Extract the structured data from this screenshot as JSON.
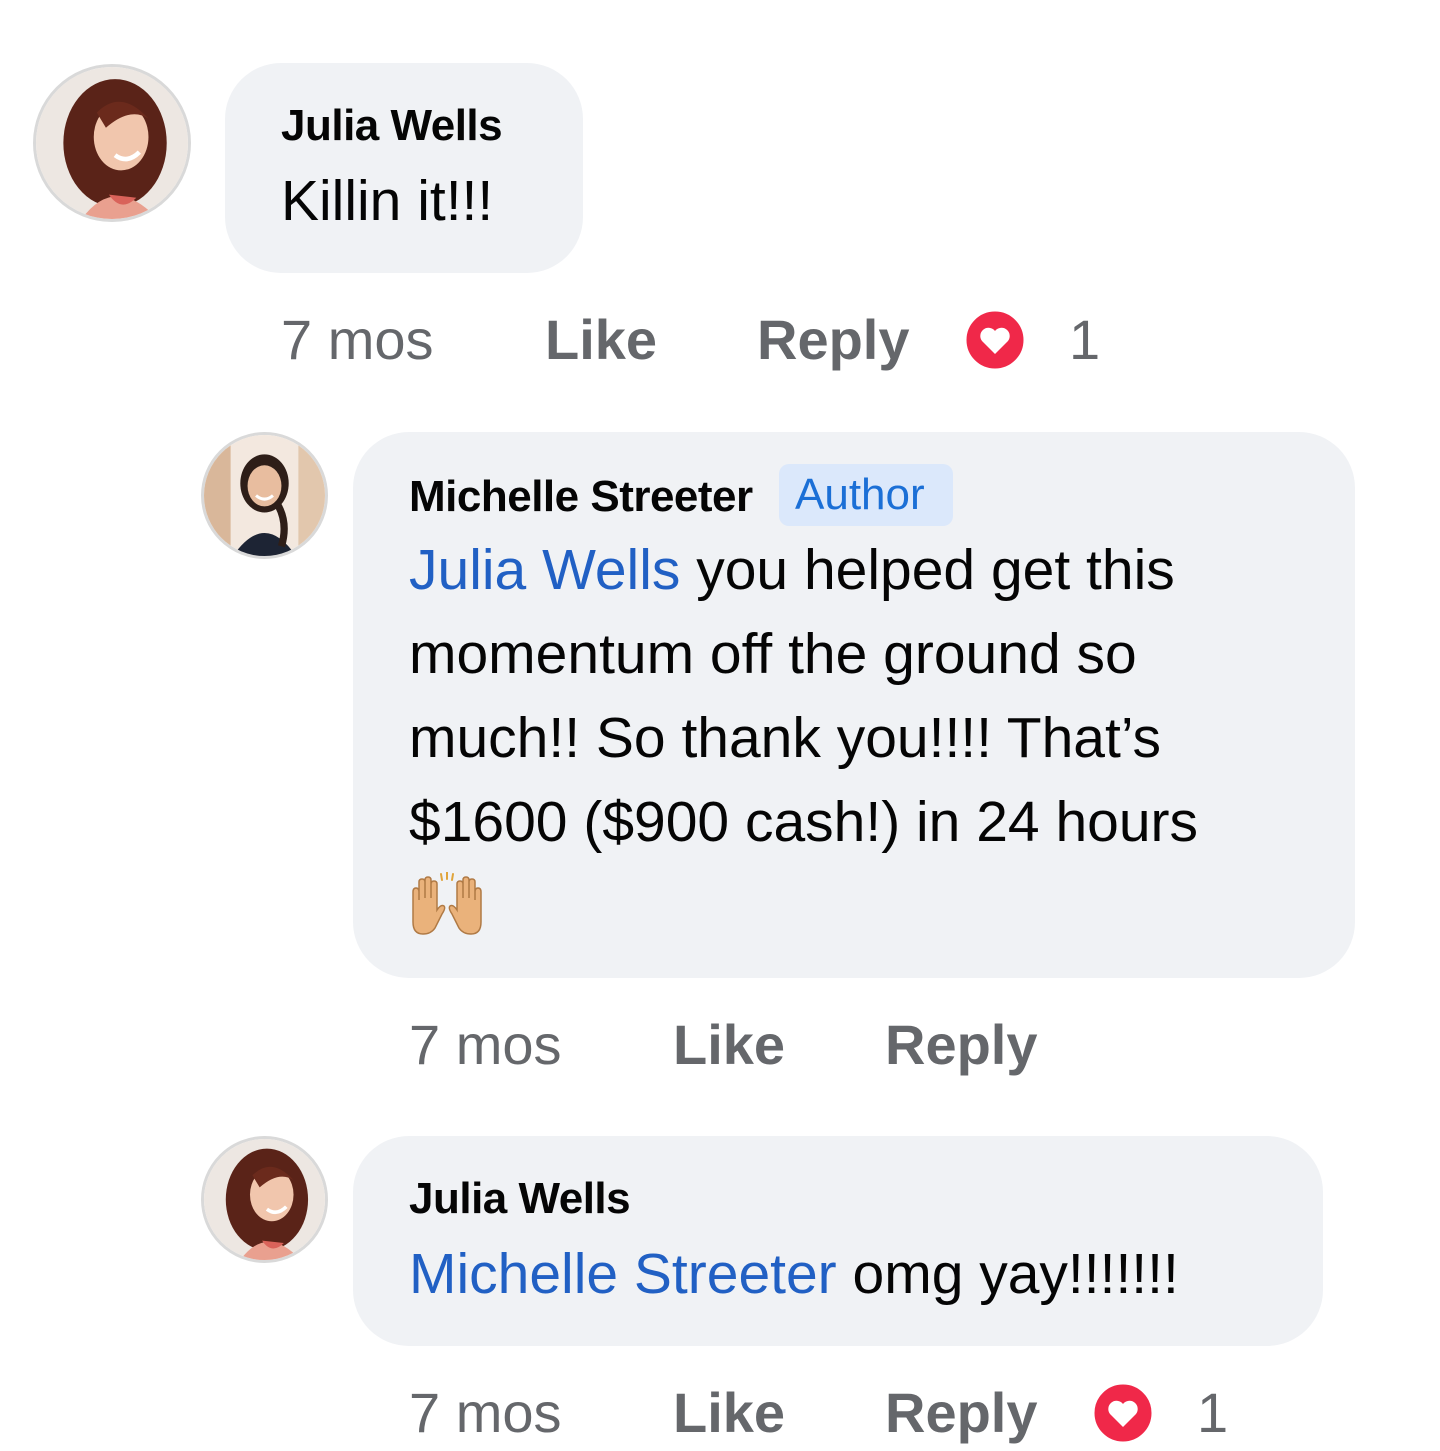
{
  "colors": {
    "bubble_bg": "#f0f2f5",
    "mention": "#2160c4",
    "meta_text": "#65676b",
    "author_badge_bg": "#dbe8fb",
    "author_badge_text": "#1b6fd6",
    "love_reaction": "#f02849"
  },
  "comments": [
    {
      "author": "Julia Wells",
      "text": "Killin it!!!",
      "time": "7 mos",
      "like_label": "Like",
      "reply_label": "Reply",
      "reaction_icon": "heart-love-icon",
      "reaction_count": "1"
    },
    {
      "author": "Michelle Streeter",
      "badge": "Author",
      "mention": "Julia Wells",
      "text_line1": " you helped get this",
      "text_line2": "momentum off the ground so",
      "text_line3": "much!! So thank you!!!! That’s",
      "text_line4": "$1600 ($900 cash!) in 24 hours",
      "emoji_icon": "raising-hands-emoji",
      "time": "7 mos",
      "like_label": "Like",
      "reply_label": "Reply"
    },
    {
      "author": "Julia Wells",
      "mention": "Michelle Streeter",
      "text": " omg yay!!!!!!!",
      "time": "7 mos",
      "like_label": "Like",
      "reply_label": "Reply",
      "reaction_icon": "heart-love-icon",
      "reaction_count": "1"
    }
  ]
}
